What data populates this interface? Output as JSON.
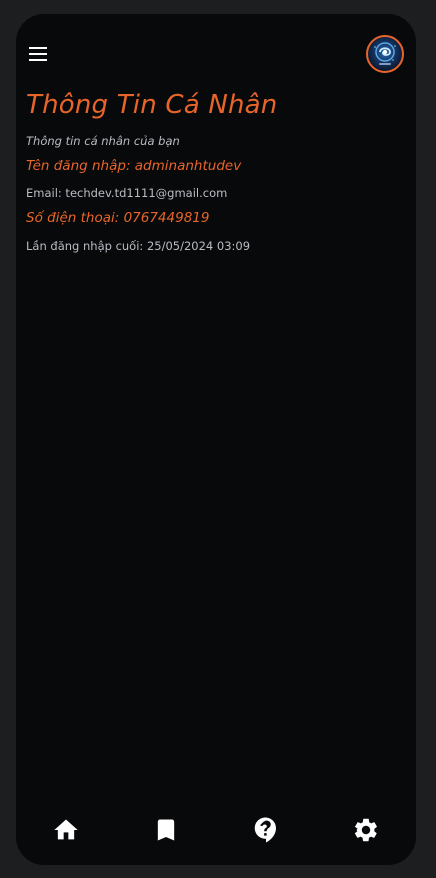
{
  "header": {
    "menu_icon": "hamburger-menu-icon",
    "avatar_icon": "user-avatar"
  },
  "profile": {
    "title": "Thông Tin Cá Nhân",
    "subtitle": "Thông tin cá nhân của bạn",
    "username": "Tên đăng nhập: adminanhtudev",
    "email": "Email: techdev.td1111@gmail.com",
    "phone": "Số điện thoại: 0767449819",
    "last_login": "Lần đăng nhập cuối: 25/05/2024 03:09"
  },
  "bottom_nav": {
    "items": [
      {
        "icon": "home-icon"
      },
      {
        "icon": "bookmark-icon"
      },
      {
        "icon": "help-icon"
      },
      {
        "icon": "settings-icon"
      }
    ]
  },
  "colors": {
    "accent": "#e8652a",
    "background": "#08090b",
    "outer_background": "#1d1e20",
    "muted_text": "#b9bcc2",
    "icon": "#ffffff"
  }
}
